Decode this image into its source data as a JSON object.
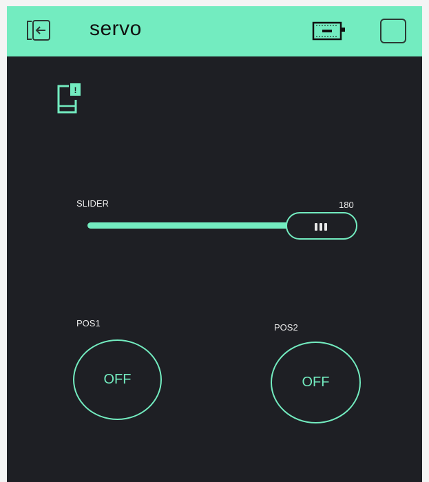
{
  "header": {
    "title": "servo",
    "back_icon": "exit-icon",
    "device_icon": "battery-device-icon",
    "stop_icon": "square-stop-icon"
  },
  "notice": {
    "icon": "phone-notification-icon",
    "badge_text": "!"
  },
  "slider": {
    "label": "SLIDER",
    "value_text": "180",
    "value": 180,
    "fill_fraction": 1.0
  },
  "buttons": [
    {
      "label": "POS1",
      "state": "OFF"
    },
    {
      "label": "POS2",
      "state": "OFF"
    }
  ],
  "colors": {
    "accent": "#73ecc0",
    "background": "#1e1f24",
    "header": "#73ecc0",
    "text": "#e9e9e9"
  }
}
